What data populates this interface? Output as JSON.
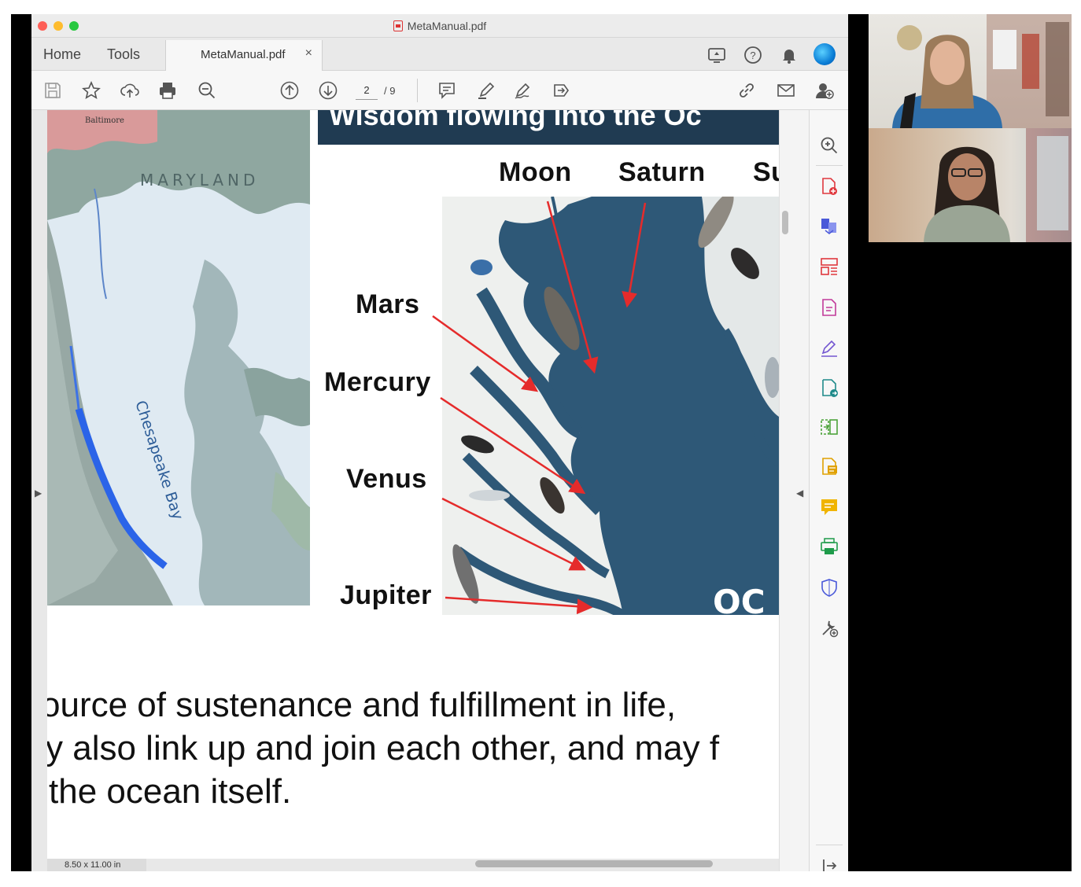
{
  "window": {
    "title": "MetaManual.pdf",
    "nav_tabs": [
      "Home",
      "Tools"
    ],
    "doc_tab": {
      "label": "MetaManual.pdf",
      "close": "×"
    }
  },
  "toolbar": {
    "icons": [
      "save-icon",
      "star-icon",
      "upload-cloud-icon",
      "print-icon",
      "zoom-out-icon",
      "page-up-icon",
      "page-down-icon",
      "comment-icon",
      "highlight-pen-icon",
      "sign-icon",
      "share-icon",
      "link-icon",
      "email-icon",
      "add-user-icon"
    ],
    "page_current": "2",
    "page_total": "/ 9"
  },
  "document": {
    "banner_text": "Wisdom flowing into the Oc",
    "left_map": {
      "labels": [
        "Baltimore",
        "MARYLAND",
        "Chesapeake Bay"
      ]
    },
    "right_map": {
      "corner_text": "OC"
    },
    "planets": [
      "Moon",
      "Saturn",
      "Su",
      "Mars",
      "Mercury",
      "Venus",
      "Jupiter"
    ],
    "body_lines": [
      "ource of sustenance and fulfillment in life,",
      "y also link up and join each other, and may f",
      "the ocean itself."
    ],
    "page_size": "8.50 x 11.00 in"
  },
  "tools_pane": {
    "icons": [
      "zoom-search-icon",
      "create-pdf-icon",
      "combine-files-icon",
      "organize-pages-icon",
      "export-pdf-icon",
      "fill-sign-icon",
      "send-review-icon",
      "compare-icon",
      "scan-ocr-icon",
      "comment-tool-icon",
      "print-production-icon",
      "protect-icon",
      "more-tools-icon",
      "collapse-pane-icon"
    ]
  },
  "colors": {
    "accent_red": "#e52b2b",
    "banner_navy": "#203b52",
    "bay_blue": "#2e5877"
  }
}
